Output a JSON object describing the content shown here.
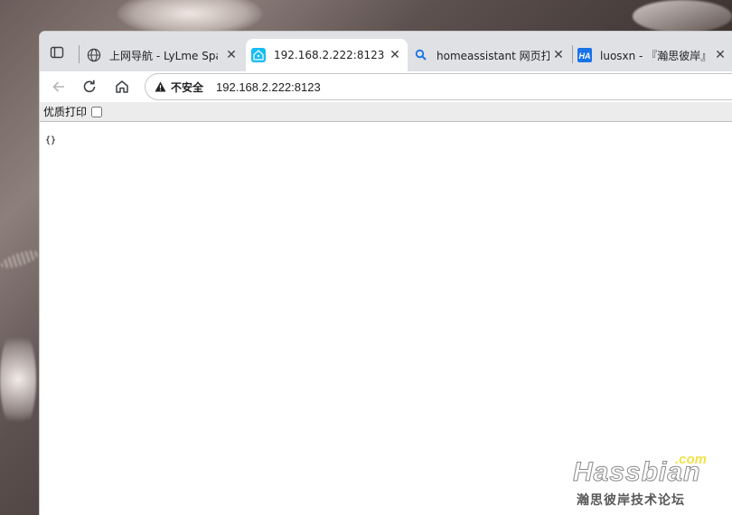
{
  "tabs": [
    {
      "title": "上网导航 - LyLme Spag",
      "favicon": "globe-icon",
      "active": false
    },
    {
      "title": "192.168.2.222:8123",
      "favicon": "home-assistant-icon",
      "active": true
    },
    {
      "title": "homeassistant 网页打不",
      "favicon": "search-icon",
      "active": false
    },
    {
      "title": "luosxn - 『瀚思彼岸』",
      "favicon": "hassbian-logo-icon",
      "active": false
    }
  ],
  "toolbar": {
    "security_label": "不安全",
    "url": "192.168.2.222:8123"
  },
  "print_bar": {
    "label": "优质打印",
    "checked": false
  },
  "content": {
    "body_text": "{}"
  },
  "watermark": {
    "brand": "Hassbian",
    "tld": ".com",
    "subtitle": "瀚思彼岸技术论坛"
  },
  "colors": {
    "tabstrip": "#dfe1e5",
    "ha_blue": "#18bcf2",
    "search_blue": "#1a73e8"
  }
}
